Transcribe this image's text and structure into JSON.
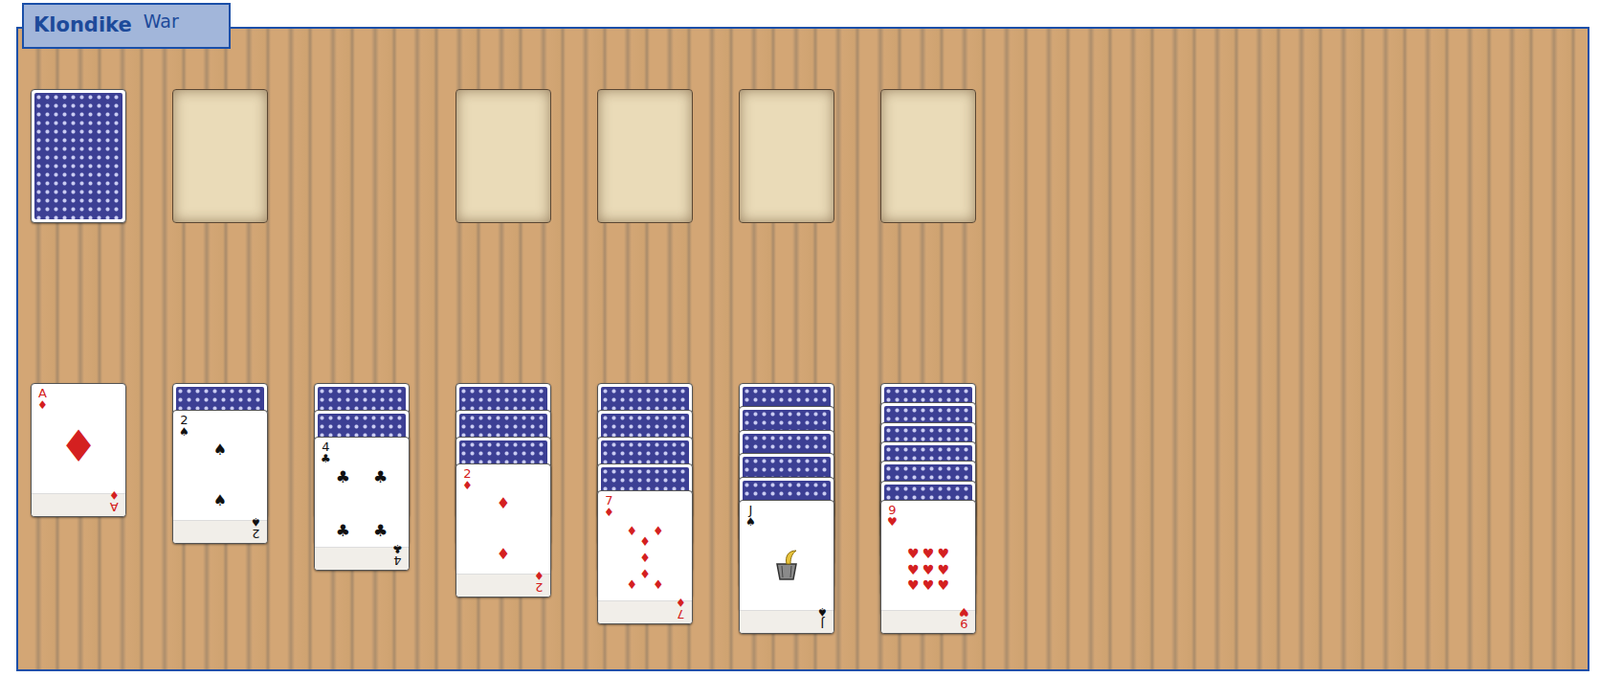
{
  "title": {
    "game": "Klondike",
    "variant": "War"
  },
  "stock": {
    "has_cards": true
  },
  "waste": {
    "has_cards": false
  },
  "foundations": [
    {
      "has_cards": false
    },
    {
      "has_cards": false
    },
    {
      "has_cards": false
    },
    {
      "has_cards": false
    }
  ],
  "tableau": [
    {
      "hidden": 0,
      "card": {
        "rank": "A",
        "suit": "♦",
        "color": "#d42020"
      }
    },
    {
      "hidden": 1,
      "card": {
        "rank": "2",
        "suit": "♠",
        "color": "#111111"
      }
    },
    {
      "hidden": 2,
      "card": {
        "rank": "4",
        "suit": "♣",
        "color": "#111111"
      }
    },
    {
      "hidden": 3,
      "card": {
        "rank": "2",
        "suit": "♦",
        "color": "#d42020"
      }
    },
    {
      "hidden": 4,
      "card": {
        "rank": "7",
        "suit": "♦",
        "color": "#d42020"
      }
    },
    {
      "hidden": 5,
      "card": {
        "rank": "J",
        "suit": "♠",
        "color": "#111111"
      }
    },
    {
      "hidden": 6,
      "card": {
        "rank": "9",
        "suit": "♥",
        "color": "#d42020"
      }
    }
  ]
}
